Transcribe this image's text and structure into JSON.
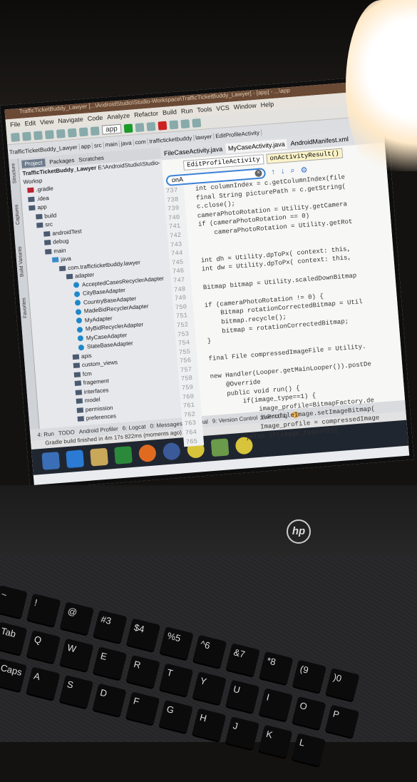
{
  "window": {
    "title": "TrafficTicketBuddy_Lawyer [...\\AndroidStudio\\Studio-Workspace\\TrafficTicketBuddy_Lawyer] - [app] - ...\\app"
  },
  "menu": [
    "File",
    "Edit",
    "View",
    "Navigate",
    "Code",
    "Analyze",
    "Refactor",
    "Build",
    "Run",
    "Tools",
    "VCS",
    "Window",
    "Help"
  ],
  "toolbar": {
    "run_config": "app",
    "breadcrumbs": [
      "com",
      "trafficticketbuddy",
      "lawyer",
      "EditProfileActivity"
    ]
  },
  "nav_path": [
    "TrafficTicketBuddy_Lawyer",
    "app",
    "src",
    "main",
    "java"
  ],
  "project_panel": {
    "tabs": [
      "Project",
      "Packages",
      "Scratches"
    ],
    "root": "TrafficTicketBuddy_Lawyer",
    "root_path": "E:\\AndroidStudio\\Studio-Worksp",
    "tree": [
      ".gradle",
      ".idea",
      "app",
      "build",
      "src",
      "androidTest",
      "debug",
      "main",
      "java",
      "com.trafficticketbuddy.lawyer",
      "adapter",
      "AcceptedCasesRecyclerAdapter",
      "CityBaseAdapter",
      "CountryBaseAdapter",
      "MadeBidRecyclerAdapter",
      "MyAdapter",
      "MyBidRecyclerAdapter",
      "MyCaseAdapter",
      "StateBaseAdapter",
      "apis",
      "custom_views",
      "fcm",
      "fragement",
      "interfaces",
      "model",
      "permission",
      "preferences"
    ]
  },
  "side_tabs": [
    "Structure",
    "Captures",
    "Build Variants",
    "Favorites"
  ],
  "editor": {
    "tabs": [
      "FileCaseActivity.java",
      "MyCaseActivity.java",
      "AndroidManifest.xml"
    ],
    "crumbs": [
      "EditProfileActivity",
      "onActivityResult()"
    ],
    "search_value": "onA",
    "line_numbers": [
      "737",
      "738",
      "739",
      "740",
      "741",
      "742",
      "743",
      "744",
      "745",
      "746",
      "747",
      "748",
      "749",
      "750",
      "751",
      "752",
      "753",
      "754",
      "755",
      "756",
      "757",
      "758",
      "759",
      "760",
      "761",
      "762",
      "763",
      "764",
      "765"
    ],
    "code": [
      "int columnIndex = c.getColumnIndex(file",
      "final String picturePath = c.getString(",
      "c.close();",
      "cameraPhotoRotation = Utility.getCamera",
      "if (cameraPhotoRotation == 0)",
      "    cameraPhotoRotation = Utility.getRot",
      "",
      "",
      "int dh = Utility.dpToPx( context: this,",
      "int dw = Utility.dpToPx( context: this,",
      "",
      "Bitmap bitmap = Utility.scaledDownBitmap",
      "",
      "if (cameraPhotoRotation != 0) {",
      "    Bitmap rotationCorrectedBitmap = Util",
      "    bitmap.recycle();",
      "    bitmap = rotationCorrectedBitmap;",
      "}",
      "",
      "final File compressedImageFile = Utility.",
      "",
      "new Handler(Looper.getMainLooper()).postDe",
      "    @Override",
      "    public void run() {",
      "        if(image_type==1) {",
      "            image_profile=BitmapFactory.de",
      "            ivProfileImage.setImageBitmap(",
      "            Image_profile = compressedImage",
      "        }else if(image_type==2){"
    ]
  },
  "bottom_tabs": [
    "4: Run",
    "TODO",
    "Android Profiler",
    "6: Logcat",
    "0: Messages",
    "Terminal",
    "9: Version Control",
    "Event Log"
  ],
  "event_count": "2",
  "status": "Gradle build finished in 4m 17s 822ms (moments ago)",
  "brand": "hp",
  "keys": [
    [
      "~",
      "!",
      "@",
      "#3",
      "$4",
      "%5",
      "^6",
      "&7",
      "*8",
      "(9",
      ")0"
    ],
    [
      "Tab",
      "Q",
      "W",
      "E",
      "R",
      "T",
      "Y",
      "U",
      "I",
      "O",
      "P"
    ],
    [
      "Caps",
      "A",
      "S",
      "D",
      "F",
      "G",
      "H",
      "J",
      "K",
      "L"
    ]
  ]
}
